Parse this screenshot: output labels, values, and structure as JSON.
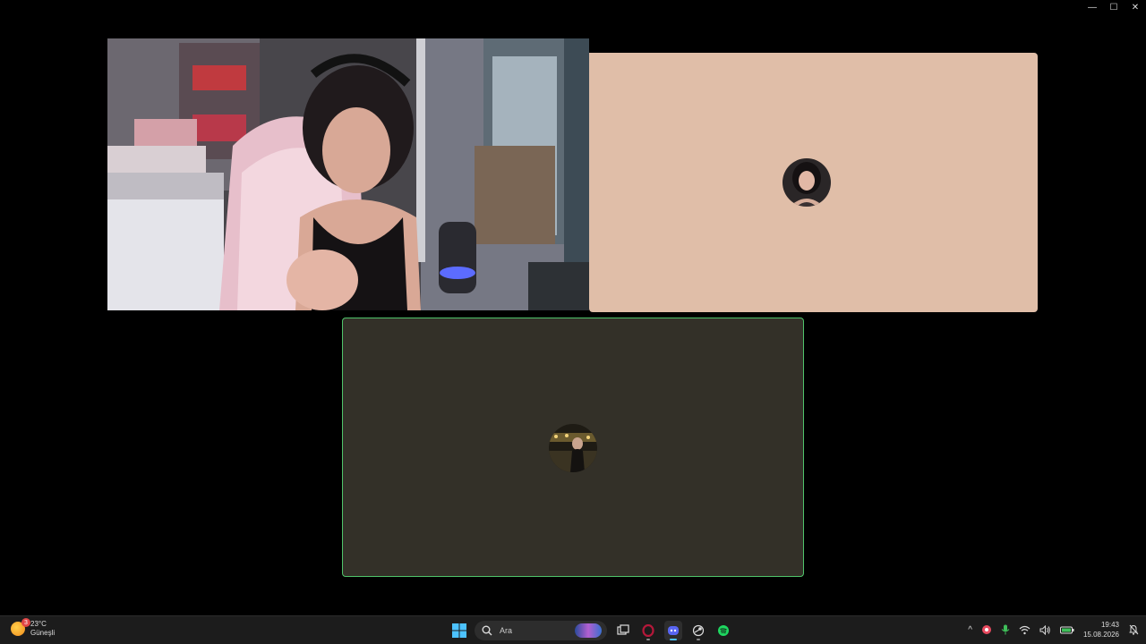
{
  "window_controls": {
    "minimize": "—",
    "maximize": "☐",
    "close": "✕"
  },
  "call": {
    "tiles": [
      {
        "id": "video",
        "type": "camera"
      },
      {
        "id": "beige",
        "type": "avatar",
        "bg": "#e0bea8"
      },
      {
        "id": "dark",
        "type": "avatar",
        "bg": "#333028",
        "speaking": true,
        "speaking_color": "#4fc46a"
      }
    ]
  },
  "taskbar": {
    "weather": {
      "temp": "23°C",
      "condition": "Güneşli",
      "badge": "3"
    },
    "search": {
      "placeholder": "Ara"
    },
    "apps": [
      "start-icon",
      "task-view-icon",
      "opera-icon",
      "discord-icon",
      "steam-icon",
      "spotify-icon"
    ],
    "tray": {
      "chevron": "^",
      "clock_time": "19:43",
      "clock_date": "15.08.2026"
    }
  }
}
